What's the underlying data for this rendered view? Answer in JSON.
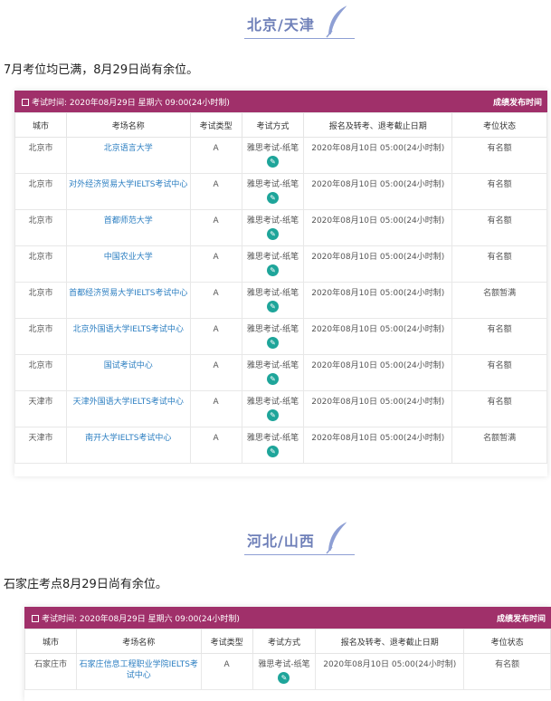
{
  "sections": [
    {
      "title": "北京/天津",
      "note": "7月考位均已满，8月29日尚有余位。",
      "bar_left": "考试时间: 2020年08月29日 星期六 09:00(24小时制)",
      "bar_right": "成绩发布时间",
      "headers": [
        "城市",
        "考场名称",
        "考试类型",
        "考试方式",
        "报名及转考、退考截止日期",
        "考位状态"
      ],
      "rows": [
        {
          "city": "北京市",
          "venue": "北京语言大学",
          "type": "A",
          "mode": "雅思考试-纸笔",
          "deadline": "2020年08月10日 05:00(24小时制)",
          "status": "有名额"
        },
        {
          "city": "北京市",
          "venue": "对外经济贸易大学IELTS考试中心",
          "type": "A",
          "mode": "雅思考试-纸笔",
          "deadline": "2020年08月10日 05:00(24小时制)",
          "status": "有名额"
        },
        {
          "city": "北京市",
          "venue": "首都师范大学",
          "type": "A",
          "mode": "雅思考试-纸笔",
          "deadline": "2020年08月10日 05:00(24小时制)",
          "status": "有名额"
        },
        {
          "city": "北京市",
          "venue": "中国农业大学",
          "type": "A",
          "mode": "雅思考试-纸笔",
          "deadline": "2020年08月10日 05:00(24小时制)",
          "status": "有名额"
        },
        {
          "city": "北京市",
          "venue": "首都经济贸易大学IELTS考试中心",
          "type": "A",
          "mode": "雅思考试-纸笔",
          "deadline": "2020年08月10日 05:00(24小时制)",
          "status": "名额暂满"
        },
        {
          "city": "北京市",
          "venue": "北京外国语大学IELTS考试中心",
          "type": "A",
          "mode": "雅思考试-纸笔",
          "deadline": "2020年08月10日 05:00(24小时制)",
          "status": "有名额"
        },
        {
          "city": "北京市",
          "venue": "国试考试中心",
          "type": "A",
          "mode": "雅思考试-纸笔",
          "deadline": "2020年08月10日 05:00(24小时制)",
          "status": "有名额"
        },
        {
          "city": "天津市",
          "venue": "天津外国语大学IELTS考试中心",
          "type": "A",
          "mode": "雅思考试-纸笔",
          "deadline": "2020年08月10日 05:00(24小时制)",
          "status": "有名额"
        },
        {
          "city": "天津市",
          "venue": "南开大学IELTS考试中心",
          "type": "A",
          "mode": "雅思考试-纸笔",
          "deadline": "2020年08月10日 05:00(24小时制)",
          "status": "名额暂满"
        }
      ]
    },
    {
      "title": "河北/山西",
      "note": "石家庄考点8月29日尚有余位。",
      "bar_left": "考试时间: 2020年08月29日 星期六 09:00(24小时制)",
      "bar_right": "成绩发布时间",
      "headers": [
        "城市",
        "考场名称",
        "考试类型",
        "考试方式",
        "报名及转考、退考截止日期",
        "考位状态"
      ],
      "rows": [
        {
          "city": "石家庄市",
          "venue": "石家庄信息工程职业学院IELTS考试中心",
          "type": "A",
          "mode": "雅思考试-纸笔",
          "deadline": "2020年08月10日 05:00(24小时制)",
          "status": "有名额"
        }
      ]
    }
  ],
  "icons": {
    "pen": "pen-icon",
    "calendar": "calendar-icon",
    "feather": "feather-icon"
  },
  "colors": {
    "header_bar": "#a0306a",
    "title": "#6e7fb8",
    "link": "#2b7ec1",
    "pen": "#1ea59a"
  }
}
